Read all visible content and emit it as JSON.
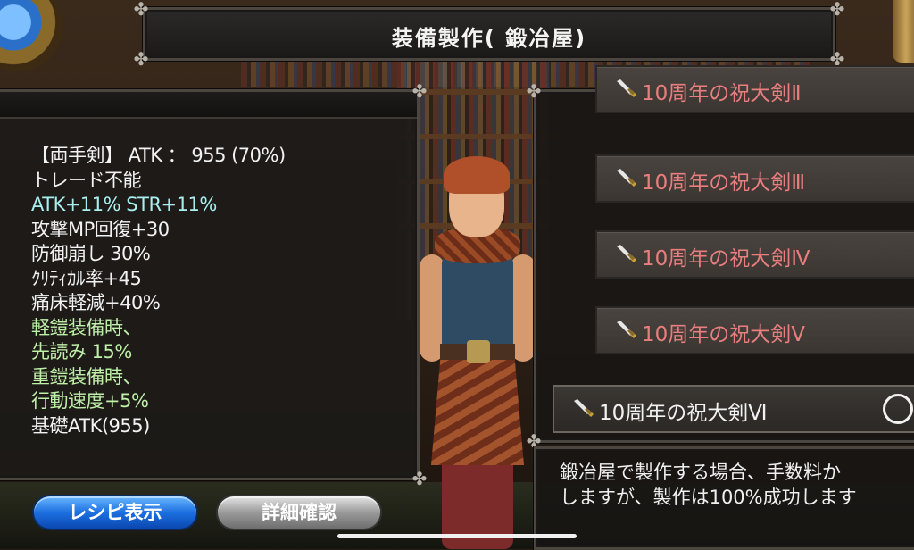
{
  "header": {
    "title": "装備製作(  鍛冶屋)"
  },
  "stats": {
    "lines": [
      {
        "text": "【両手剣】  ATK  ：  955   (70%)",
        "color": "white"
      },
      {
        "text": "トレード不能",
        "color": "white"
      },
      {
        "text": "ATK+11%  STR+11%",
        "color": "cyan"
      },
      {
        "text": "攻撃MP回復+30",
        "color": "white"
      },
      {
        "text": "防御崩し 30%",
        "color": "white"
      },
      {
        "text": "ｸﾘﾃｨｶﾙ率+45",
        "color": "white"
      },
      {
        "text": "痛床軽減+40%",
        "color": "white"
      },
      {
        "text": "軽鎧装備時、",
        "color": "green"
      },
      {
        "text": "先読み 15%",
        "color": "green"
      },
      {
        "text": "重鎧装備時、",
        "color": "green"
      },
      {
        "text": "行動速度+5%",
        "color": "green"
      },
      {
        "text": "基礎ATK(955)",
        "color": "white"
      }
    ]
  },
  "recipes": {
    "items": [
      {
        "label": "10周年の祝大剣Ⅱ",
        "selected": false
      },
      {
        "label": "10周年の祝大剣Ⅲ",
        "selected": false
      },
      {
        "label": "10周年の祝大剣Ⅳ",
        "selected": false
      },
      {
        "label": "10周年の祝大剣Ⅴ",
        "selected": false
      },
      {
        "label": "10周年の祝大剣Ⅵ",
        "selected": true
      }
    ]
  },
  "message": {
    "line1": "鍛冶屋で製作する場合、手数料か",
    "line2": "しますが、製作は100%成功します"
  },
  "buttons": {
    "recipe": "レシピ表示",
    "detail": "詳細確認"
  },
  "colors": {
    "white": "#f2f2f2",
    "cyan": "#a8f0f0",
    "green": "#bff0a8",
    "unavailable": "#e87e7e",
    "recipe_button": "#1d6fe0"
  },
  "icons": {
    "item_icon": "sword-icon",
    "select_icon": "radio-circle-icon"
  }
}
